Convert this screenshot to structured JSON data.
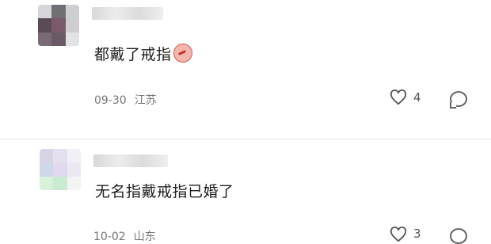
{
  "comments": [
    {
      "content": "都戴了戒指",
      "emoji": "shy-emoji",
      "date": "09-30",
      "location": "江苏",
      "likes": "4"
    },
    {
      "content": "无名指戴戒指已婚了",
      "date": "10-02",
      "location": "山东",
      "likes": "3"
    }
  ],
  "colors": {
    "text": "#1f1f1f",
    "meta": "#777777",
    "icon": "#555555"
  }
}
